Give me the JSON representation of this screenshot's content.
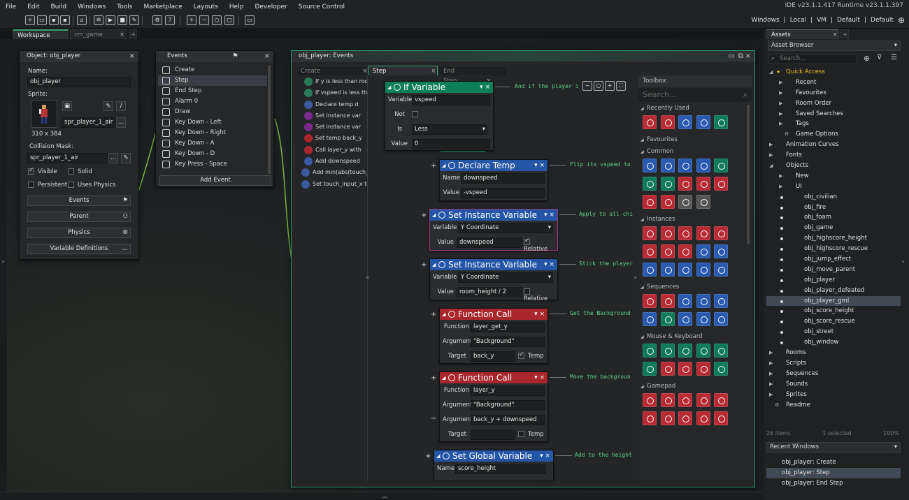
{
  "menu": [
    "File",
    "Edit",
    "Build",
    "Windows",
    "Tools",
    "Marketplace",
    "Layouts",
    "Help",
    "Developer",
    "Source Control"
  ],
  "version": "IDE v23.1.1.417  Runtime v23.1.1.397",
  "target_bar": [
    "Windows",
    "Local",
    "VM",
    "Default",
    "Default"
  ],
  "workspace_tabs": [
    {
      "label": "Workspace 1",
      "active": true
    },
    {
      "label": "rm_game",
      "active": false
    }
  ],
  "object_panel": {
    "title": "Object: obj_player",
    "name_label": "Name:",
    "name_value": "obj_player",
    "sprite_label": "Sprite:",
    "sprite_name": "spr_player_1_air",
    "sprite_size": "310 x 384",
    "collision_label": "Collision Mask:",
    "collision_value": "spr_player_1_air",
    "visible_label": "Visible",
    "solid_label": "Solid",
    "persistent_label": "Persistent",
    "physics_check_label": "Uses Physics",
    "events_btn": "Events",
    "parent_btn": "Parent",
    "physics_btn": "Physics",
    "vardefs_btn": "Variable Definitions"
  },
  "events_panel": {
    "title": "Events",
    "items": [
      "Create",
      "Step",
      "End Step",
      "Alarm 0",
      "Draw",
      "Key Down - Left",
      "Key Down - Right",
      "Key Down - A",
      "Key Down - D",
      "Key Press - Space"
    ],
    "add_event": "Add Event"
  },
  "editor": {
    "title": "obj_player: Events",
    "tabs": [
      "Create",
      "Step",
      "End Step"
    ],
    "list": [
      "If y is less than room",
      "If vspeed is less th",
      "Declare temp d",
      "Set instance var",
      "Set instance var",
      "Set temp back_y",
      "Call layer_y with",
      "Add downspeed",
      "Add min(abs(touch_",
      "Set touch_input_x to"
    ]
  },
  "blocks": {
    "ifvar": {
      "title": "If Variable",
      "variable_k": "Variable",
      "variable_v": "vspeed",
      "not_k": "Not",
      "is_k": "Is",
      "is_v": "Less",
      "value_k": "Value",
      "value_v": "0",
      "comment": "And if the player i"
    },
    "declare": {
      "title": "Declare Temp",
      "name_k": "Name",
      "name_v": "downspeed",
      "value_k": "Value",
      "value_v": "-vspeed",
      "comment": "Flip its vspeed to"
    },
    "setinst1": {
      "title": "Set Instance Variable",
      "var_k": "Variable",
      "var_v": "Y Coordinate",
      "value_k": "Value",
      "value_v": "downspeed",
      "relative": "Relative",
      "comment": "Apply to all chi"
    },
    "setinst2": {
      "title": "Set Instance Variable",
      "var_k": "Variable",
      "var_v": "Y Coordinate",
      "value_k": "Value",
      "value_v": "room_height / 2",
      "relative": "Relative",
      "comment": "Stick the player"
    },
    "func1": {
      "title": "Function Call",
      "function_k": "Function",
      "function_v": "layer_get_y",
      "arg_k": "Argument",
      "arg_v": "\"Background\"",
      "target_k": "Target",
      "target_v": "back_y",
      "temp": "Temp",
      "comment": "Get the Background"
    },
    "func2": {
      "title": "Function Call",
      "function_k": "Function",
      "function_v": "layer_y",
      "arg_k": "Argument",
      "arg1_v": "\"Background\"",
      "arg2_v": "back_y + downspeed",
      "target_k": "Target",
      "temp": "Temp",
      "comment": "Move the backgroun"
    },
    "setglobal": {
      "title": "Set Global Variable",
      "name_k": "Name",
      "name_v": "score_height",
      "comment": "Add to the height"
    }
  },
  "toolbox": {
    "title": "Toolbox",
    "search": "Search...",
    "sections": [
      "Recently Used",
      "Favourites",
      "Common",
      "Instances",
      "Sequences",
      "Mouse & Keyboard",
      "Gamepad"
    ]
  },
  "assets": {
    "tab": "Assets",
    "browser": "Asset Browser",
    "search": "Search...",
    "tree": [
      {
        "label": "Quick Access",
        "level": 0,
        "arrow": "down",
        "star": true
      },
      {
        "label": "Recent",
        "level": 1,
        "arrow": "right"
      },
      {
        "label": "Favourites",
        "level": 1,
        "arrow": "right"
      },
      {
        "label": "Room Order",
        "level": 1,
        "arrow": "right"
      },
      {
        "label": "Saved Searches",
        "level": 1,
        "arrow": "right"
      },
      {
        "label": "Tags",
        "level": 1,
        "arrow": "right"
      },
      {
        "label": "Game Options",
        "level": 1,
        "arrow": "none"
      },
      {
        "label": "Animation Curves",
        "level": 0,
        "arrow": "right"
      },
      {
        "label": "Fonts",
        "level": 0,
        "arrow": "right"
      },
      {
        "label": "Objects",
        "level": 0,
        "arrow": "down"
      },
      {
        "label": "New",
        "level": 1,
        "arrow": "right"
      },
      {
        "label": "UI",
        "level": 1,
        "arrow": "right"
      },
      {
        "label": "obj_civilian",
        "level": 1,
        "arrow": "dot"
      },
      {
        "label": "obj_fire",
        "level": 1,
        "arrow": "dot"
      },
      {
        "label": "obj_foam",
        "level": 1,
        "arrow": "dot"
      },
      {
        "label": "obj_game",
        "level": 1,
        "arrow": "dot"
      },
      {
        "label": "obj_highscore_height",
        "level": 1,
        "arrow": "dot"
      },
      {
        "label": "obj_highscore_rescue",
        "level": 1,
        "arrow": "dot"
      },
      {
        "label": "obj_jump_effect",
        "level": 1,
        "arrow": "dot"
      },
      {
        "label": "obj_move_parent",
        "level": 1,
        "arrow": "dot"
      },
      {
        "label": "obj_player",
        "level": 1,
        "arrow": "dot"
      },
      {
        "label": "obj_player_defeated",
        "level": 1,
        "arrow": "dot"
      },
      {
        "label": "obj_player_gml",
        "level": 1,
        "arrow": "dot",
        "selected": true
      },
      {
        "label": "obj_score_height",
        "level": 1,
        "arrow": "dot"
      },
      {
        "label": "obj_score_rescue",
        "level": 1,
        "arrow": "dot"
      },
      {
        "label": "obj_street",
        "level": 1,
        "arrow": "dot"
      },
      {
        "label": "obj_window",
        "level": 1,
        "arrow": "dot"
      },
      {
        "label": "Rooms",
        "level": 0,
        "arrow": "right"
      },
      {
        "label": "Scripts",
        "level": 0,
        "arrow": "right"
      },
      {
        "label": "Sequences",
        "level": 0,
        "arrow": "right"
      },
      {
        "label": "Sounds",
        "level": 0,
        "arrow": "right"
      },
      {
        "label": "Sprites",
        "level": 0,
        "arrow": "right"
      },
      {
        "label": "Readme",
        "level": 0,
        "arrow": "none"
      }
    ],
    "footer_items": "26 items",
    "footer_selected": "1 selected",
    "footer_zoom": "100%"
  },
  "recent_windows": {
    "title": "Recent Windows",
    "items": [
      "obj_player: Create",
      "obj_player: Step",
      "obj_player: End Step"
    ]
  }
}
